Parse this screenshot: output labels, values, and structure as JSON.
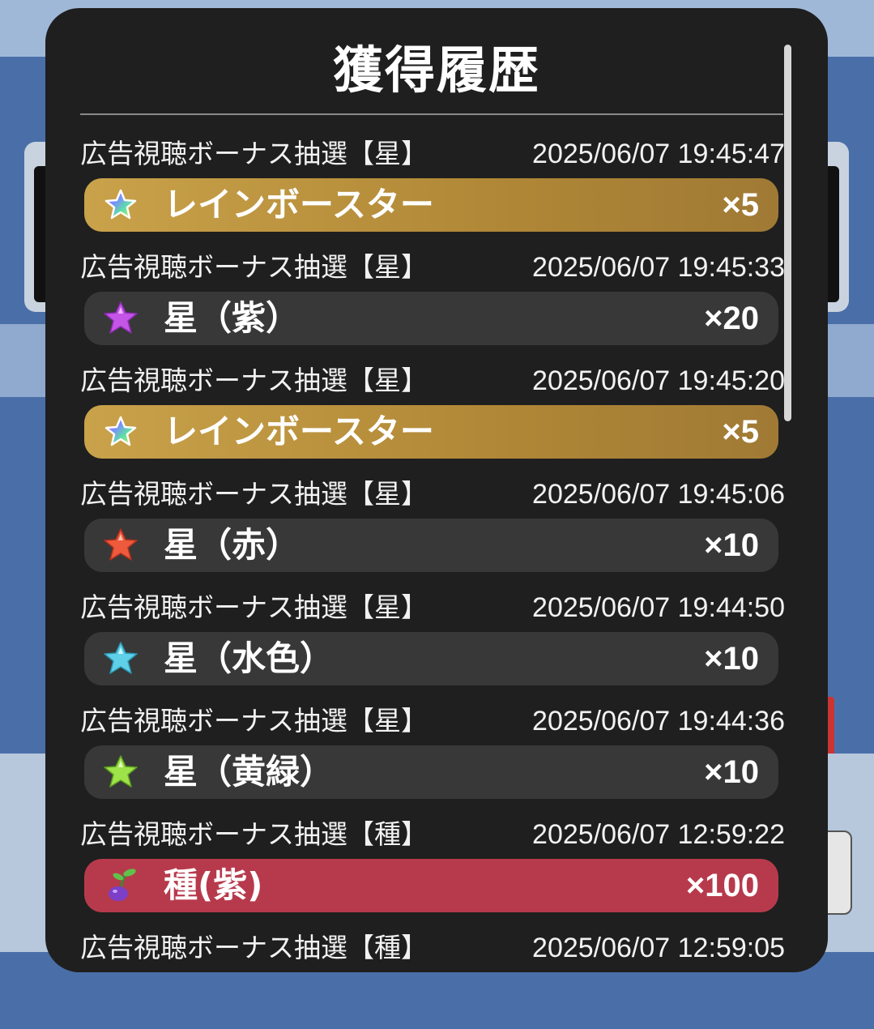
{
  "modal": {
    "title": "獲得履歴"
  },
  "entries": [
    {
      "source": "広告視聴ボーナス抽選【星】",
      "timestamp": "2025/06/07 19:45:47",
      "item": "レインボースター",
      "qty": "×5",
      "style": "gold",
      "icon": "rainbow-star-icon"
    },
    {
      "source": "広告視聴ボーナス抽選【星】",
      "timestamp": "2025/06/07 19:45:33",
      "item": "星（紫）",
      "qty": "×20",
      "style": "gray",
      "icon": "purple-star-icon"
    },
    {
      "source": "広告視聴ボーナス抽選【星】",
      "timestamp": "2025/06/07 19:45:20",
      "item": "レインボースター",
      "qty": "×5",
      "style": "gold",
      "icon": "rainbow-star-icon"
    },
    {
      "source": "広告視聴ボーナス抽選【星】",
      "timestamp": "2025/06/07 19:45:06",
      "item": "星（赤）",
      "qty": "×10",
      "style": "gray",
      "icon": "red-star-icon"
    },
    {
      "source": "広告視聴ボーナス抽選【星】",
      "timestamp": "2025/06/07 19:44:50",
      "item": "星（水色）",
      "qty": "×10",
      "style": "gray",
      "icon": "light-blue-star-icon"
    },
    {
      "source": "広告視聴ボーナス抽選【星】",
      "timestamp": "2025/06/07 19:44:36",
      "item": "星（黄緑）",
      "qty": "×10",
      "style": "gray",
      "icon": "yellow-green-star-icon"
    },
    {
      "source": "広告視聴ボーナス抽選【種】",
      "timestamp": "2025/06/07 12:59:22",
      "item": "種(紫)",
      "qty": "×100",
      "style": "red",
      "icon": "purple-seed-icon"
    },
    {
      "source": "広告視聴ボーナス抽選【種】",
      "timestamp": "2025/06/07 12:59:05",
      "item": "",
      "qty": "",
      "style": "gray",
      "icon": ""
    }
  ],
  "colors": {
    "gold": "#c9a24a",
    "gray": "#383838",
    "red": "#b73a4c",
    "modal_bg": "#1f1f1f"
  }
}
